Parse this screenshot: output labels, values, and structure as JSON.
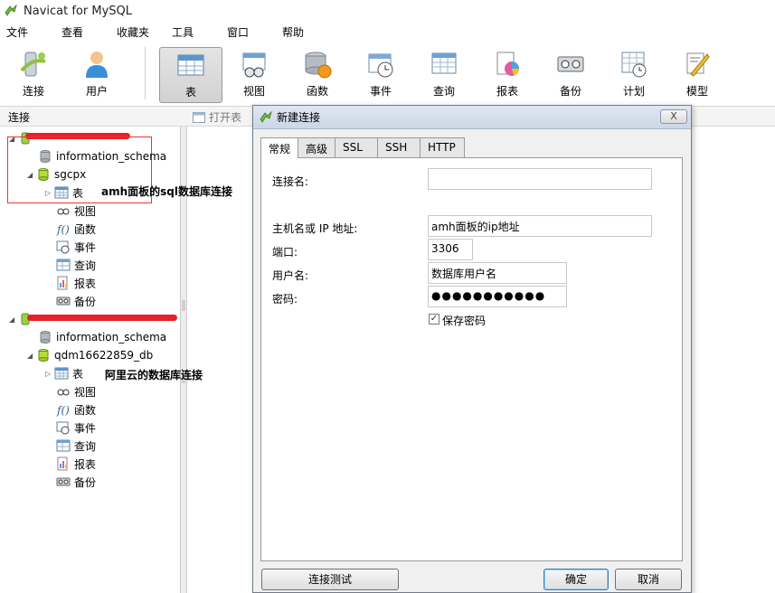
{
  "window": {
    "title": "Navicat for MySQL"
  },
  "menu": [
    "文件",
    "查看",
    "收藏夹",
    "工具",
    "窗口",
    "帮助"
  ],
  "toolbar": {
    "items": [
      {
        "label": "连接",
        "icon": "connection-icon"
      },
      {
        "label": "用户",
        "icon": "user-icon"
      },
      {
        "label": "表",
        "icon": "table-icon",
        "active": true
      },
      {
        "label": "视图",
        "icon": "view-icon"
      },
      {
        "label": "函数",
        "icon": "function-icon"
      },
      {
        "label": "事件",
        "icon": "event-icon"
      },
      {
        "label": "查询",
        "icon": "query-icon"
      },
      {
        "label": "报表",
        "icon": "report-icon"
      },
      {
        "label": "备份",
        "icon": "backup-icon"
      },
      {
        "label": "计划",
        "icon": "schedule-icon"
      },
      {
        "label": "模型",
        "icon": "model-icon"
      }
    ]
  },
  "left_panel": {
    "header": "连接",
    "tree": [
      {
        "label": "information_schema"
      },
      {
        "label": "sgcpx"
      },
      {
        "label": "表"
      },
      {
        "label": "视图"
      },
      {
        "label": "函数"
      },
      {
        "label": "事件"
      },
      {
        "label": "查询"
      },
      {
        "label": "报表"
      },
      {
        "label": "备份"
      },
      {
        "label": "information_schema"
      },
      {
        "label": "qdm16622859_db"
      },
      {
        "label": "表"
      },
      {
        "label": "视图"
      },
      {
        "label": "函数"
      },
      {
        "label": "事件"
      },
      {
        "label": "查询"
      },
      {
        "label": "报表"
      },
      {
        "label": "备份"
      }
    ]
  },
  "annotations": {
    "first": "amh面板的sql数据库连接",
    "second": "阿里云的数据库连接"
  },
  "object_toolbar": {
    "open_label": "打开表"
  },
  "dialog": {
    "title": "新建连接",
    "close_label": "X",
    "tabs": [
      "常规",
      "高级",
      "SSL",
      "SSH",
      "HTTP"
    ],
    "fields": {
      "conn_name_label": "连接名:",
      "conn_name_value": "",
      "host_label": "主机名或 IP 地址:",
      "host_value": "amh面板的ip地址",
      "port_label": "端口:",
      "port_value": "3306",
      "user_label": "用户名:",
      "user_value": "数据库用户名",
      "password_label": "密码:",
      "password_value": "●●●●●●●●●●●",
      "save_password_label": "保存密码",
      "save_password_checked": true
    },
    "buttons": {
      "test": "连接测试",
      "ok": "确定",
      "cancel": "取消"
    }
  }
}
